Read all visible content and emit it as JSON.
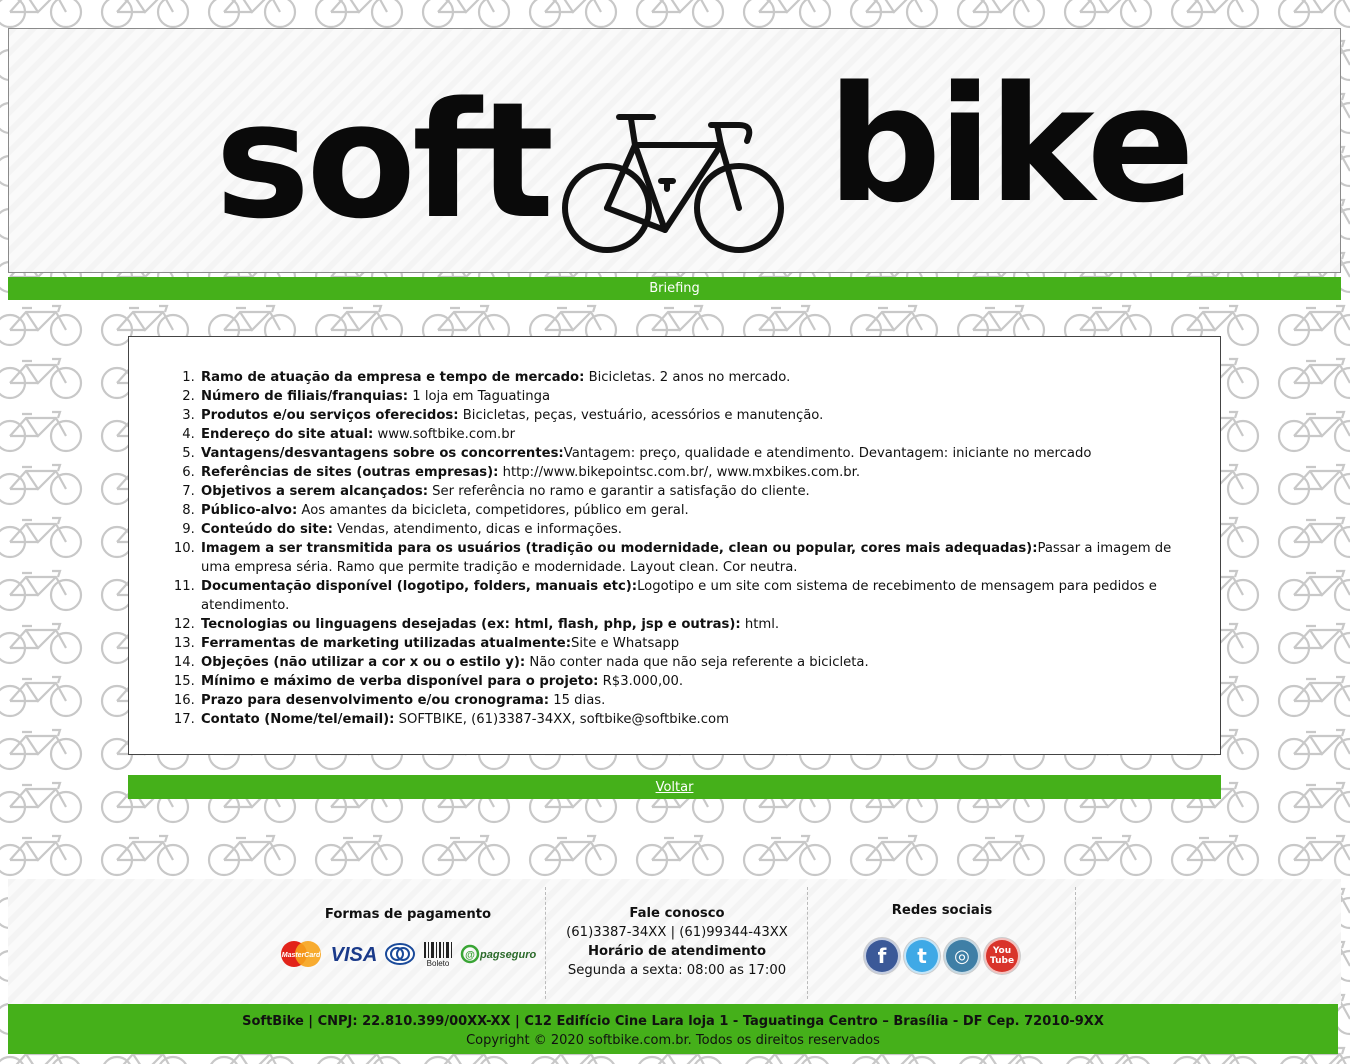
{
  "header": {
    "logo_left": "soft",
    "logo_right": "bike"
  },
  "briefing_bar": {
    "label": "Briefing"
  },
  "briefing": {
    "items": [
      {
        "q": "Ramo de atuação da empresa e tempo de mercado:",
        "a": " Bicicletas. 2 anos no mercado."
      },
      {
        "q": "Número de filiais/franquias:",
        "a": " 1 loja em Taguatinga"
      },
      {
        "q": "Produtos e/ou serviços oferecidos:",
        "a": " Bicicletas, peças, vestuário, acessórios e manutenção."
      },
      {
        "q": "Endereço do site atual:",
        "a": " www.softbike.com.br"
      },
      {
        "q": "Vantagens/desvantagens sobre os concorrentes:",
        "a": "Vantagem: preço, qualidade e atendimento. Devantagem: iniciante no mercado"
      },
      {
        "q": "Referências de sites (outras empresas):",
        "a": " http://www.bikepointsc.com.br/, www.mxbikes.com.br."
      },
      {
        "q": "Objetivos a serem alcançados:",
        "a": " Ser referência no ramo e garantir a satisfação do cliente."
      },
      {
        "q": "Público-alvo:",
        "a": " Aos amantes da bicicleta, competidores, público em geral."
      },
      {
        "q": "Conteúdo do site:",
        "a": " Vendas, atendimento, dicas e informações."
      },
      {
        "q": "Imagem a ser transmitida para os usuários (tradição ou modernidade, clean ou popular, cores mais adequadas):",
        "a": "Passar a imagem de uma empresa séria. Ramo que permite tradição e modernidade. Layout clean. Cor neutra."
      },
      {
        "q": "Documentação disponível (logotipo, folders, manuais etc):",
        "a": "Logotipo e um site com sistema de recebimento de mensagem para pedidos e atendimento."
      },
      {
        "q": "Tecnologias ou linguagens desejadas (ex: html, flash, php, jsp e outras):",
        "a": " html."
      },
      {
        "q": "Ferramentas de marketing utilizadas atualmente:",
        "a": "Site e Whatsapp"
      },
      {
        "q": "Objeções (não utilizar a cor x ou o estilo y):",
        "a": " Não conter nada que não seja referente a bicicleta."
      },
      {
        "q": "Mínimo e máximo de verba disponível para o projeto:",
        "a": " R$3.000,00."
      },
      {
        "q": "Prazo para desenvolvimento e/ou cronograma:",
        "a": " 15 dias."
      },
      {
        "q": "Contato (Nome/tel/email):",
        "a": " SOFTBIKE, (61)3387-34XX, softbike@softbike.com"
      }
    ]
  },
  "back": {
    "label": "Voltar"
  },
  "footer": {
    "payment": {
      "title": "Formas de pagamento",
      "methods": [
        "MasterCard",
        "VISA",
        "Diners",
        "Boleto",
        "pagseguro"
      ]
    },
    "contact": {
      "title": "Fale conosco",
      "phones": "(61)3387-34XX | (61)99344-43XX",
      "hours_title": "Horário de atendimento",
      "hours": "Segunda a sexta: 08:00 as 17:00"
    },
    "social": {
      "title": "Redes sociais",
      "networks": [
        {
          "name": "facebook",
          "glyph": "f",
          "color": "#3b5998"
        },
        {
          "name": "twitter",
          "glyph": "t",
          "color": "#3fa9e6"
        },
        {
          "name": "instagram",
          "glyph": "◎",
          "color": "#3f7fa6"
        },
        {
          "name": "youtube",
          "glyph": "You Tube",
          "color": "#d9342b"
        }
      ]
    },
    "company_line": "SoftBike | CNPJ: 22.810.399/00XX-XX | C12 Edifício Cine Lara loja 1 - Taguatinga Centro – Brasília - DF Cep. 72010-9XX",
    "copyright": "Copyright © 2020 softbike.com.br. Todos os direitos reservados"
  }
}
